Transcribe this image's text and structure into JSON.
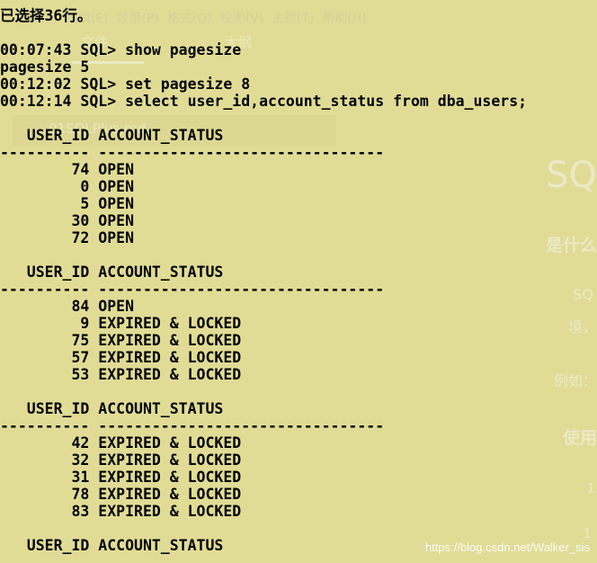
{
  "background": {
    "menu_items": [
      "文件(F)",
      "编辑(E)",
      "段落(P)",
      "格式(O)",
      "视图(V)",
      "主题(T)",
      "帮助(H)"
    ],
    "tabs": [
      "文件",
      "大纲"
    ],
    "open_file": "01SQLPlus.md",
    "right_fragments": [
      "SQ",
      "是什么",
      "SQ",
      "境，",
      "例如：",
      "使用",
      "1",
      "1"
    ]
  },
  "terminal": {
    "lines": [
      "已选择36行。",
      "",
      "00:07:43 SQL> show pagesize",
      "pagesize 5",
      "00:12:02 SQL> set pagesize 8",
      "00:12:14 SQL> select user_id,account_status from dba_users;",
      "",
      "   USER_ID ACCOUNT_STATUS",
      "---------- --------------------------------",
      "        74 OPEN",
      "         0 OPEN",
      "         5 OPEN",
      "        30 OPEN",
      "        72 OPEN",
      "",
      "   USER_ID ACCOUNT_STATUS",
      "---------- --------------------------------",
      "        84 OPEN",
      "         9 EXPIRED & LOCKED",
      "        75 EXPIRED & LOCKED",
      "        57 EXPIRED & LOCKED",
      "        53 EXPIRED & LOCKED",
      "",
      "   USER_ID ACCOUNT_STATUS",
      "---------- --------------------------------",
      "        42 EXPIRED & LOCKED",
      "        32 EXPIRED & LOCKED",
      "        31 EXPIRED & LOCKED",
      "        78 EXPIRED & LOCKED",
      "        83 EXPIRED & LOCKED",
      "",
      "   USER_ID ACCOUNT_STATUS"
    ]
  },
  "watermark": "https://blog.csdn.net/Walker_sis"
}
